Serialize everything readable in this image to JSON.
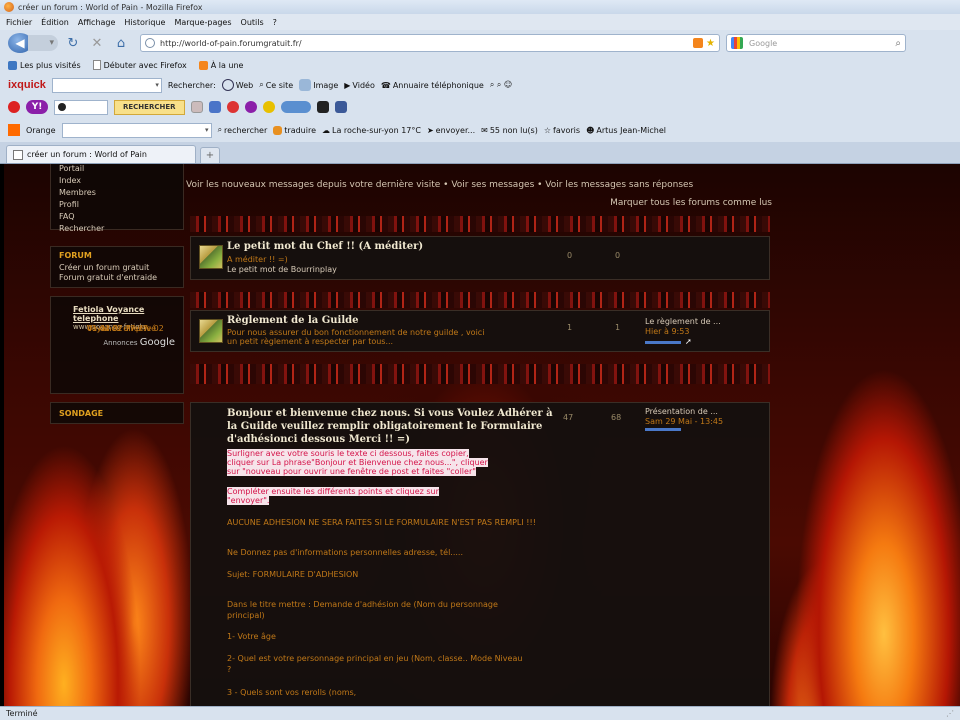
{
  "window": {
    "title": "créer un forum : World of Pain - Mozilla Firefox"
  },
  "menu": [
    "Fichier",
    "Édition",
    "Affichage",
    "Historique",
    "Marque-pages",
    "Outils",
    "?"
  ],
  "nav": {
    "url": "http://world-of-pain.forumgratuit.fr/",
    "search_placeholder": "Google"
  },
  "bookmarks": [
    "Les plus visités",
    "Débuter avec Firefox",
    "À la une"
  ],
  "ixquick_bar": {
    "logo": "ixquick",
    "search_label": "Rechercher:",
    "items": [
      "Web",
      "Ce site",
      "Image",
      "Vidéo",
      "Annuaire téléphonique"
    ]
  },
  "yahoo_bar": {
    "button": "RECHERCHER"
  },
  "orange_bar": {
    "label": "Orange",
    "items": [
      "rechercher",
      "traduire",
      "La roche-sur-yon 17°C",
      "envoyer...",
      "55 non lu(s)",
      "favoris",
      "Artus Jean-Michel"
    ]
  },
  "tab": {
    "label": "créer un forum : World of Pain"
  },
  "sidebar": {
    "links": [
      "Portail",
      "Index",
      "Membres",
      "Profil",
      "FAQ",
      "Rechercher"
    ],
    "forum_heading": "FORUM",
    "forum_links": [
      "Créer un forum gratuit",
      "Forum gratuit d'entraide"
    ],
    "ad": {
      "title": "Fetiola Voyance telephone",
      "lines": [
        "Voyance directe 02",
        "41 02 77 77",
        "Voyance en privé",
        "01 44 02 77 77",
        "www.voyance-fetiola"
      ],
      "annonces": "Annonces",
      "google": "Google"
    },
    "sondage": "SONDAGE"
  },
  "top_links": "Voir les nouveaux messages depuis votre dernière visite • Voir ses messages • Voir les messages sans réponses",
  "mark_all": "Marquer tous les forums comme lus",
  "forums": [
    {
      "title": "Le petit mot du Chef !! (A méditer)",
      "sub": "A méditer !! =)",
      "desc": "Le petit mot de Bourrinplay",
      "topics": "0",
      "posts": "0"
    },
    {
      "title": "Règlement de la Guilde",
      "sub1": "Pour nous assurer du bon fonctionnement de notre guilde , voici",
      "sub2": "un petit règlement à respecter par tous...",
      "topics": "1",
      "posts": "1",
      "last_title": "Le règlement de ...",
      "last_date": "Hier à 9:53"
    },
    {
      "title": "Bonjour et bienvenue chez nous. Si vous Voulez Adhérer à la Guilde veuillez remplir obligatoirement le Formulaire d'adhésionci dessous Merci !! =)",
      "pink1": [
        "Surligner avec votre souris le texte ci dessous, faites copier,",
        "cliquer sur La phrase\"Bonjour et Bienvenue chez nous...\", cliquer",
        "sur \"nouveau pour ouvrir une fenêtre de post et faites \"coller\""
      ],
      "pink2": [
        "Compléter ensuite les différents points et cliquez sur",
        "\"envoyer\"."
      ],
      "lines": [
        "AUCUNE ADHESION NE SERA FAITES SI LE FORMULAIRE N'EST PAS REMPLI !!!",
        "Ne Donnez pas d'informations personnelles adresse, tél.....",
        "Sujet: FORMULAIRE D'ADHESION",
        "Dans le titre mettre : Demande d'adhésion de (Nom du personnage principal)",
        "1- Votre âge",
        "2- Quel est votre personnage principal en jeu (Nom, classe.. Mode Niveau ?",
        "3 - Quels sont vos rerolls (noms,"
      ],
      "topics": "47",
      "posts": "68",
      "last_title": "Présentation de ...",
      "last_date": "Sam 29 Mai - 13:45"
    }
  ],
  "status": "Terminé"
}
